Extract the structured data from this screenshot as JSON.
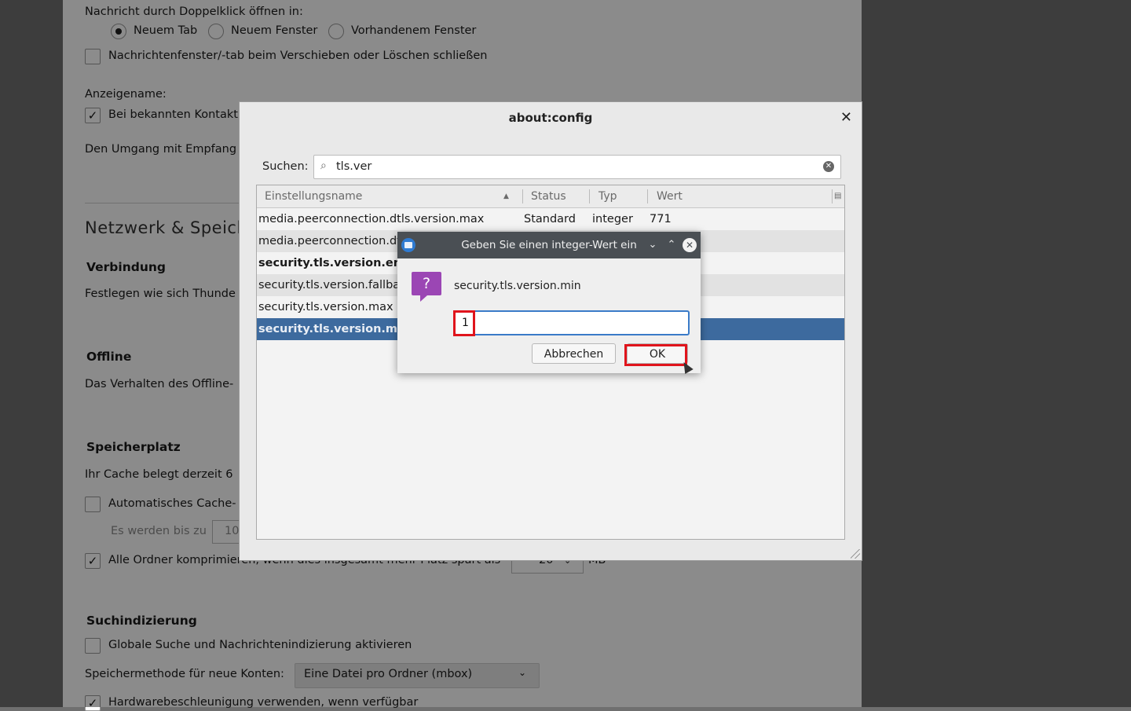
{
  "settings": {
    "open_message_label": "Nachricht durch Doppelklick öffnen in:",
    "open_options": [
      "Neuem Tab",
      "Neuem Fenster",
      "Vorhandenem Fenster"
    ],
    "close_on_move_label": "Nachrichtenfenster/-tab beim Verschieben oder Löschen schließen",
    "display_name_label": "Anzeigename:",
    "known_contacts_label": "Bei bekannten Kontakt",
    "recipients_label": "Den Umgang mit Empfang",
    "network_section": "Netzwerk & Speich",
    "connection_heading": "Verbindung",
    "connection_text": "Festlegen wie sich Thunde",
    "offline_heading": "Offline",
    "offline_text": "Das Verhalten des Offline-",
    "storage_heading": "Speicherplatz",
    "cache_text": "Ihr Cache belegt derzeit 6",
    "auto_cache_label": "Automatisches Cache-",
    "cache_limit_label": "Es werden bis zu",
    "cache_limit_value": "10",
    "compact_label": "Alle Ordner komprimieren, wenn dies insgesamt mehr Platz spart als",
    "compact_value": "20",
    "compact_unit": "MB",
    "search_index_heading": "Suchindizierung",
    "global_search_label": "Globale Suche und Nachrichtenindizierung aktivieren",
    "storage_method_label": "Speichermethode für neue Konten:",
    "storage_method_value": "Eine Datei pro Ordner (mbox)",
    "hw_accel_label": "Hardwarebeschleunigung verwenden, wenn verfügbar"
  },
  "config_window": {
    "title": "about:config",
    "search_label": "Suchen:",
    "search_value": "tls.ver",
    "columns": [
      "Einstellungsname",
      "Status",
      "Typ",
      "Wert"
    ],
    "rows": [
      {
        "name": "media.peerconnection.dtls.version.max",
        "status": "Standard",
        "type": "integer",
        "value": "771"
      },
      {
        "name": "media.peerconnection.dtl",
        "status": "",
        "type": "",
        "value": ""
      },
      {
        "name": "security.tls.version.ena",
        "status": "",
        "type": "",
        "value": ""
      },
      {
        "name": "security.tls.version.fallbac",
        "status": "",
        "type": "",
        "value": ""
      },
      {
        "name": "security.tls.version.max",
        "status": "",
        "type": "",
        "value": ""
      },
      {
        "name": "security.tls.version.mi",
        "status": "",
        "type": "",
        "value": ""
      }
    ]
  },
  "prompt_dialog": {
    "title": "Geben Sie einen integer-Wert ein",
    "pref_name": "security.tls.version.min",
    "input_value": "1",
    "cancel_label": "Abbrechen",
    "ok_label": "OK"
  },
  "colors": {
    "selection": "#3d6a9e",
    "highlight": "#e0141c",
    "question_icon": "#9b46b4",
    "titlebar": "#4a4f54"
  }
}
